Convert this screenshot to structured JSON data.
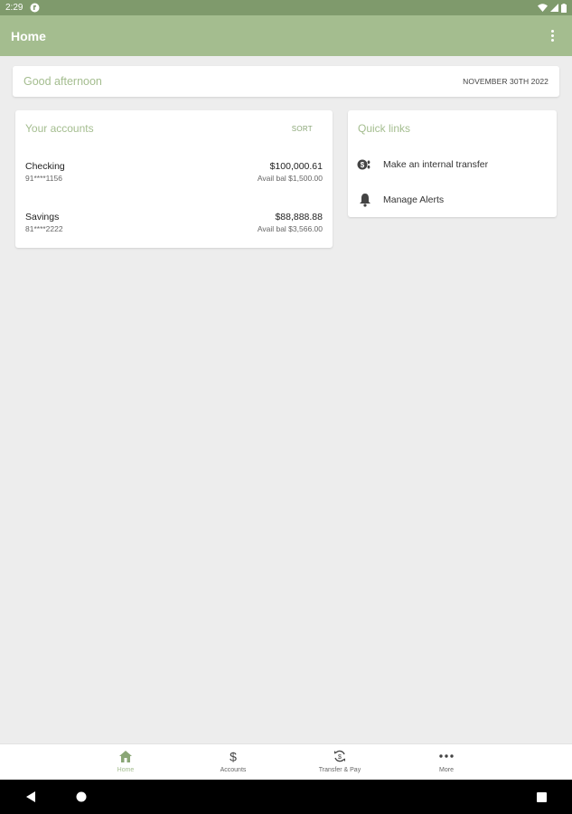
{
  "status_bar": {
    "time": "2:29",
    "colors": {
      "background": "#7f9a6c"
    }
  },
  "app_bar": {
    "title": "Home",
    "menu_icon": "more-vert-icon",
    "colors": {
      "background": "#a4bd8f",
      "title": "#ffffff"
    }
  },
  "greeting": {
    "text": "Good afternoon",
    "date": "NOVEMBER 30TH 2022"
  },
  "accounts": {
    "title": "Your accounts",
    "sort_label": "SORT",
    "items": [
      {
        "name": "Checking",
        "number": "91****1156",
        "balance": "$100,000.61",
        "available": "Avail bal $1,500.00"
      },
      {
        "name": "Savings",
        "number": "81****2222",
        "balance": "$88,888.88",
        "available": "Avail bal $3,566.00"
      }
    ]
  },
  "quick_links": {
    "title": "Quick links",
    "items": [
      {
        "label": "Make an internal transfer",
        "icon": "transfer-icon"
      },
      {
        "label": "Manage Alerts",
        "icon": "bell-icon"
      }
    ]
  },
  "bottom_nav": {
    "items": [
      {
        "label": "Home",
        "icon": "home-icon",
        "active": true
      },
      {
        "label": "Accounts",
        "icon": "dollar-icon",
        "active": false
      },
      {
        "label": "Transfer & Pay",
        "icon": "transfer-pay-icon",
        "active": false
      },
      {
        "label": "More",
        "icon": "more-horiz-icon",
        "active": false
      }
    ]
  },
  "accent_color": "#a4bd8f"
}
